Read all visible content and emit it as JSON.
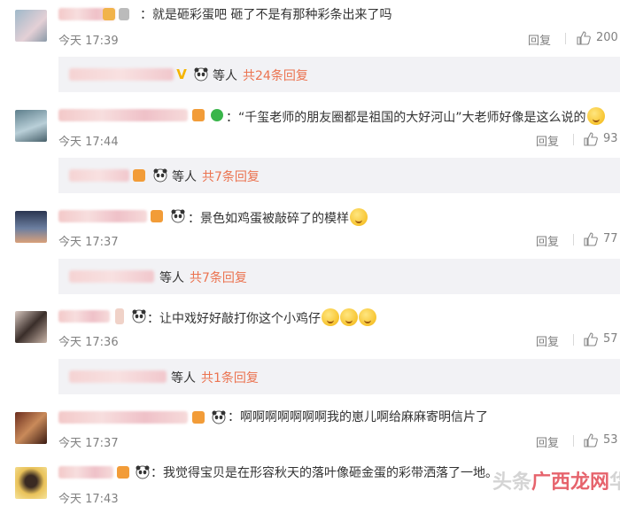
{
  "comments": [
    {
      "text": "：就是砸彩蛋吧 砸了不是有那种彩条出来了吗",
      "time": "今天 17:39",
      "reply_label": "回复",
      "likes": "200"
    },
    {
      "text": "：“千玺老师的朋友圈都是祖国的大好河山”大老师好像是这么说的",
      "time": "今天 17:44",
      "reply_label": "回复",
      "likes": "93"
    },
    {
      "text": "：景色如鸡蛋被敲碎了的模样",
      "time": "今天 17:37",
      "reply_label": "回复",
      "likes": "77"
    },
    {
      "text": "：让中戏好好敲打你这个小鸡仔",
      "time": "今天 17:36",
      "reply_label": "回复",
      "likes": "57"
    },
    {
      "text": "：啊啊啊啊啊啊啊我的崽儿啊给麻麻寄明信片了",
      "time": "今天 17:37",
      "reply_label": "回复",
      "likes": "53"
    },
    {
      "text": "：我觉得宝贝是在形容秋天的落叶像砸金蛋的彩带洒落了一地。",
      "time": "今天 17:43",
      "reply_label": "回复",
      "likes": ""
    }
  ],
  "sub_replies": [
    {
      "suffix": "等人",
      "count_label": "共24条回复"
    },
    {
      "suffix": "等人",
      "count_label": "共7条回复"
    },
    {
      "suffix": "等人",
      "count_label": "共7条回复"
    },
    {
      "suffix": "等人",
      "count_label": "共1条回复"
    }
  ],
  "watermark": {
    "prefix": "头条",
    "accent": "广西龙网",
    "suffix": "华童"
  },
  "colors": {
    "link": "#eb7350",
    "meta": "#808080",
    "sub_bg": "#f2f2f5",
    "badge_v": "#f5b400",
    "badge_green": "#39b54a"
  },
  "icons": {
    "like": "thumbs-up-icon",
    "panda": "panda-icon",
    "vip": "vip-crown-icon"
  }
}
